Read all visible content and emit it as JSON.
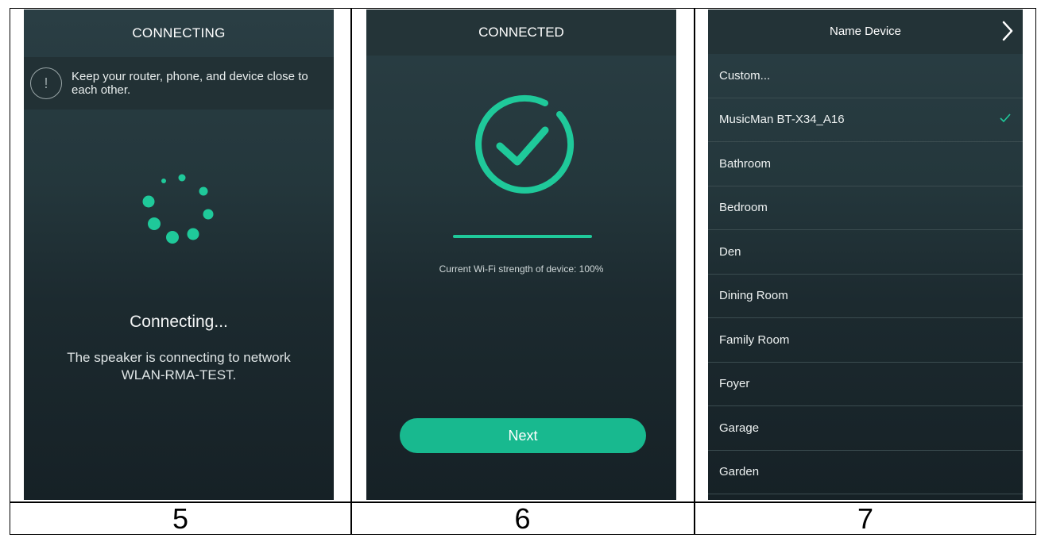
{
  "steps": [
    "5",
    "6",
    "7"
  ],
  "connecting": {
    "title": "CONNECTING",
    "tip": "Keep your router, phone, and device close to each other.",
    "heading": "Connecting...",
    "desc_line1": "The speaker is connecting to network",
    "desc_line2": "WLAN-RMA-TEST."
  },
  "connected": {
    "title": "CONNECTED",
    "wifi_strength_text": "Current Wi-Fi strength of device: 100%",
    "wifi_strength": 1.0,
    "next_label": "Next"
  },
  "name_device": {
    "title": "Name Device",
    "options": [
      "Custom...",
      "MusicMan BT-X34_A16",
      "Bathroom",
      "Bedroom",
      "Den",
      "Dining Room",
      "Family Room",
      "Foyer",
      "Garage",
      "Garden"
    ],
    "selected": "MusicMan BT-X34_A16"
  },
  "colors": {
    "accent": "#1fc99a",
    "button": "#18b98f"
  }
}
